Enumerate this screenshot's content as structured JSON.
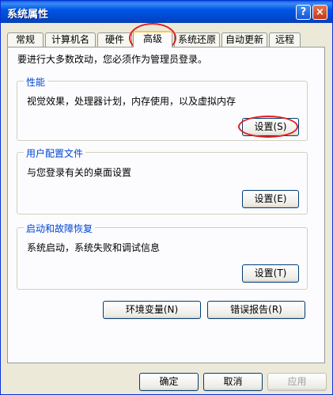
{
  "window": {
    "title": "系统属性",
    "help_label": "?",
    "close_label": "×"
  },
  "tabs": [
    {
      "label": "常规"
    },
    {
      "label": "计算机名"
    },
    {
      "label": "硬件"
    },
    {
      "label": "高级",
      "active": true
    },
    {
      "label": "系统还原"
    },
    {
      "label": "自动更新"
    },
    {
      "label": "远程"
    }
  ],
  "notice": "要进行大多数改动，您必须作为管理员登录。",
  "performance": {
    "title": "性能",
    "desc": "视觉效果，处理器计划，内存使用，以及虚拟内存",
    "button": "设置(S)"
  },
  "profiles": {
    "title": "用户配置文件",
    "desc": "与您登录有关的桌面设置",
    "button": "设置(E)"
  },
  "startup": {
    "title": "启动和故障恢复",
    "desc": "系统启动，系统失败和调试信息",
    "button": "设置(T)"
  },
  "env_button": "环境变量(N)",
  "error_button": "错误报告(R)",
  "footer": {
    "ok": "确定",
    "cancel": "取消",
    "apply": "应用"
  },
  "annotation_color": "#e02020"
}
